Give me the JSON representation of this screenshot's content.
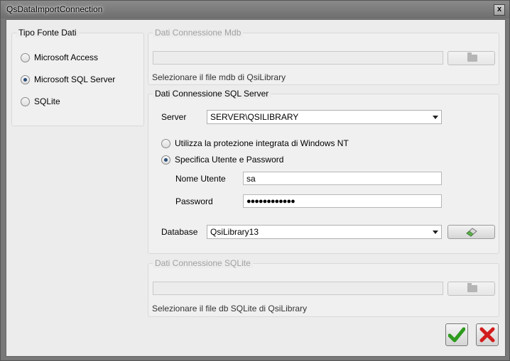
{
  "window": {
    "title": "QsDataImportConnection",
    "close": "x"
  },
  "tipo": {
    "legend": "Tipo Fonte Dati",
    "options": [
      {
        "label": "Microsoft Access",
        "checked": false
      },
      {
        "label": "Microsoft SQL Server",
        "checked": true
      },
      {
        "label": "SQLite",
        "checked": false
      }
    ]
  },
  "mdb": {
    "legend": "Dati Connessione Mdb",
    "path": "",
    "hint": "Selezionare il file mdb di QsiLibrary",
    "browse_icon": "folder-icon"
  },
  "sql": {
    "legend": "Dati Connessione SQL Server",
    "server_label": "Server",
    "server_value": "SERVER\\QSILIBRARY",
    "auth_options": [
      {
        "label": "Utilizza la protezione integrata di Windows NT",
        "checked": false
      },
      {
        "label": "Specifica Utente e Password",
        "checked": true
      }
    ],
    "user_label": "Nome Utente",
    "user_value": "sa",
    "password_label": "Password",
    "password_value": "●●●●●●●●●●●●",
    "database_label": "Database",
    "database_value": "QsiLibrary13",
    "test_icon": "eraser-icon"
  },
  "sqlite": {
    "legend": "Dati Connessione SQLite",
    "path": "",
    "hint": "Selezionare il file db SQLite di QsiLibrary",
    "browse_icon": "folder-icon"
  },
  "buttons": {
    "ok_icon": "checkmark-icon",
    "cancel_icon": "x-icon",
    "ok_color": "#2e9a1e",
    "cancel_color": "#d21d1d"
  }
}
